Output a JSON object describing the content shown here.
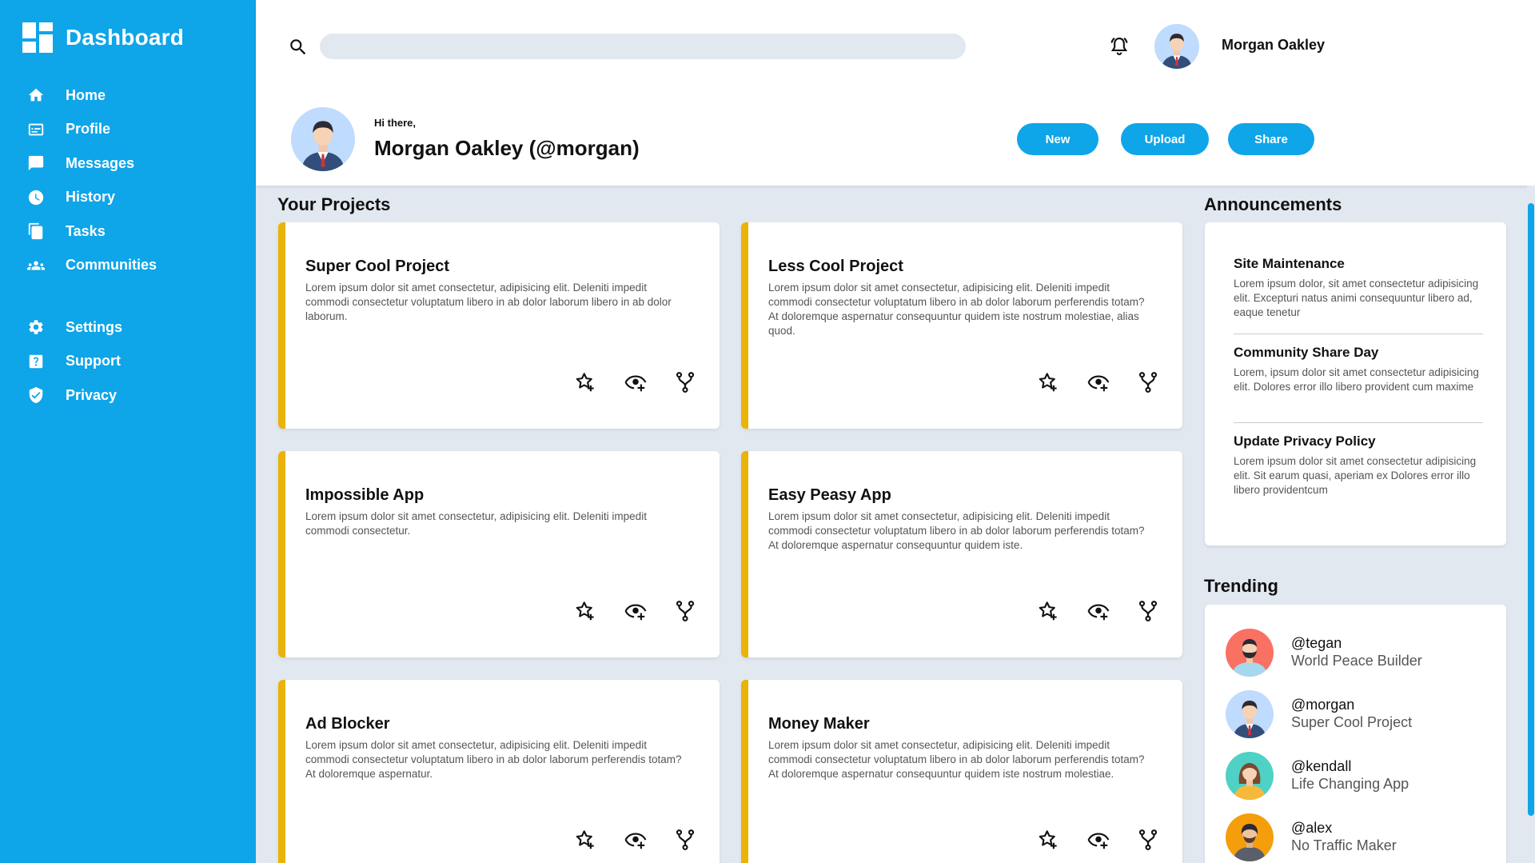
{
  "brand": {
    "title": "Dashboard"
  },
  "colors": {
    "accent": "#0ea5e9",
    "card_border": "#eab308",
    "background": "#e2e8f0"
  },
  "sidebar": {
    "items": [
      {
        "label": "Home",
        "icon": "home-icon"
      },
      {
        "label": "Profile",
        "icon": "id-card-icon"
      },
      {
        "label": "Messages",
        "icon": "chat-icon"
      },
      {
        "label": "History",
        "icon": "clock-icon"
      },
      {
        "label": "Tasks",
        "icon": "copy-icon"
      },
      {
        "label": "Communities",
        "icon": "group-icon"
      }
    ],
    "secondary": [
      {
        "label": "Settings",
        "icon": "gear-icon"
      },
      {
        "label": "Support",
        "icon": "help-icon"
      },
      {
        "label": "Privacy",
        "icon": "shield-icon"
      }
    ]
  },
  "header": {
    "search_placeholder": "",
    "username": "Morgan Oakley",
    "greeting": "Hi there,",
    "full_name": "Morgan Oakley (@morgan)",
    "buttons": {
      "new": "New",
      "upload": "Upload",
      "share": "Share"
    }
  },
  "projects": {
    "title": "Your Projects",
    "cards": [
      {
        "title": "Super Cool Project",
        "desc": "Lorem ipsum dolor sit amet consectetur, adipisicing elit. Deleniti impedit commodi consectetur voluptatum libero in ab dolor laborum libero in ab dolor laborum."
      },
      {
        "title": "Less Cool Project",
        "desc": "Lorem ipsum dolor sit amet consectetur, adipisicing elit. Deleniti impedit commodi consectetur voluptatum libero in ab dolor laborum perferendis totam? At doloremque aspernatur consequuntur quidem iste nostrum molestiae, alias quod."
      },
      {
        "title": "Impossible App",
        "desc": "Lorem ipsum dolor sit amet consectetur, adipisicing elit. Deleniti impedit commodi consectetur."
      },
      {
        "title": "Easy Peasy App",
        "desc": "Lorem ipsum dolor sit amet consectetur, adipisicing elit. Deleniti impedit commodi consectetur voluptatum libero in ab dolor laborum perferendis totam? At doloremque aspernatur consequuntur quidem iste."
      },
      {
        "title": "Ad Blocker",
        "desc": "Lorem ipsum dolor sit amet consectetur, adipisicing elit. Deleniti impedit commodi consectetur voluptatum libero in ab dolor laborum perferendis totam? At doloremque aspernatur."
      },
      {
        "title": "Money Maker",
        "desc": "Lorem ipsum dolor sit amet consectetur, adipisicing elit. Deleniti impedit commodi consectetur voluptatum libero in ab dolor laborum perferendis totam? At doloremque aspernatur consequuntur quidem iste nostrum molestiae."
      }
    ]
  },
  "announcements": {
    "title": "Announcements",
    "items": [
      {
        "title": "Site Maintenance",
        "desc": "Lorem ipsum dolor, sit amet consectetur adipisicing elit. Excepturi natus animi consequuntur libero ad, eaque tenetur"
      },
      {
        "title": "Community Share Day",
        "desc": "Lorem, ipsum dolor sit amet consectetur adipisicing elit. Dolores error illo libero provident cum maxime"
      },
      {
        "title": "Update Privacy Policy",
        "desc": "Lorem ipsum dolor sit amet consectetur adipisicing elit. Sit earum quasi, aperiam ex Dolores error illo libero providentcum"
      }
    ]
  },
  "trending": {
    "title": "Trending",
    "items": [
      {
        "handle": "@tegan",
        "project": "World Peace Builder"
      },
      {
        "handle": "@morgan",
        "project": "Super Cool Project"
      },
      {
        "handle": "@kendall",
        "project": "Life Changing App"
      },
      {
        "handle": "@alex",
        "project": "No Traffic Maker"
      }
    ]
  }
}
